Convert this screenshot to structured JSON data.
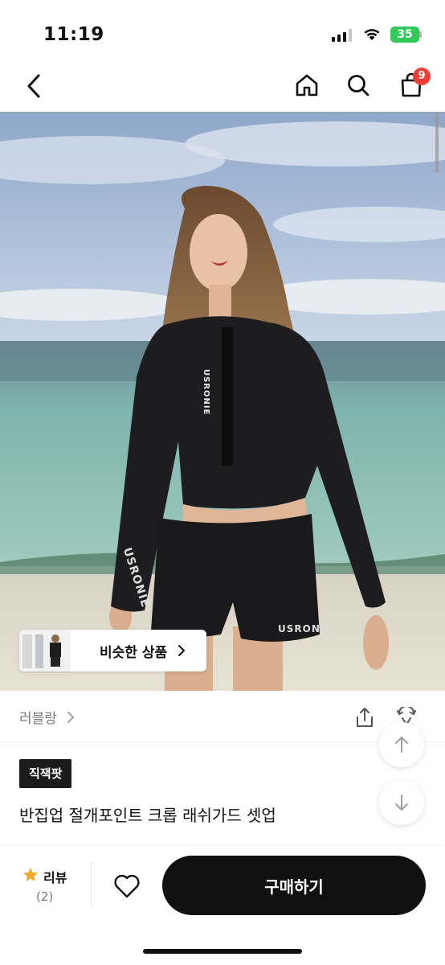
{
  "status_bar": {
    "time": "11:19",
    "battery": "35"
  },
  "nav": {
    "back_icon": "chevron-left-icon",
    "home_icon": "home-icon",
    "search_icon": "search-icon",
    "cart_icon": "shopping-bag-icon",
    "cart_count": "9",
    "badge_color": "#ef3e36"
  },
  "hero": {
    "similar_label": "비슷한 상품",
    "print_top": "USRONIE",
    "print_sleeve": "USRONIE",
    "print_shorts": "USRONIE"
  },
  "product": {
    "shop_name": "러블랑",
    "badge": "직잭팟",
    "title": "반집업 절개포인트 크롭 래쉬가드 셋업"
  },
  "bottom_bar": {
    "review_label": "리뷰",
    "review_count": "(2)",
    "buy_label": "구매하기",
    "accent_color": "#111111",
    "star_color": "#f5a623"
  }
}
